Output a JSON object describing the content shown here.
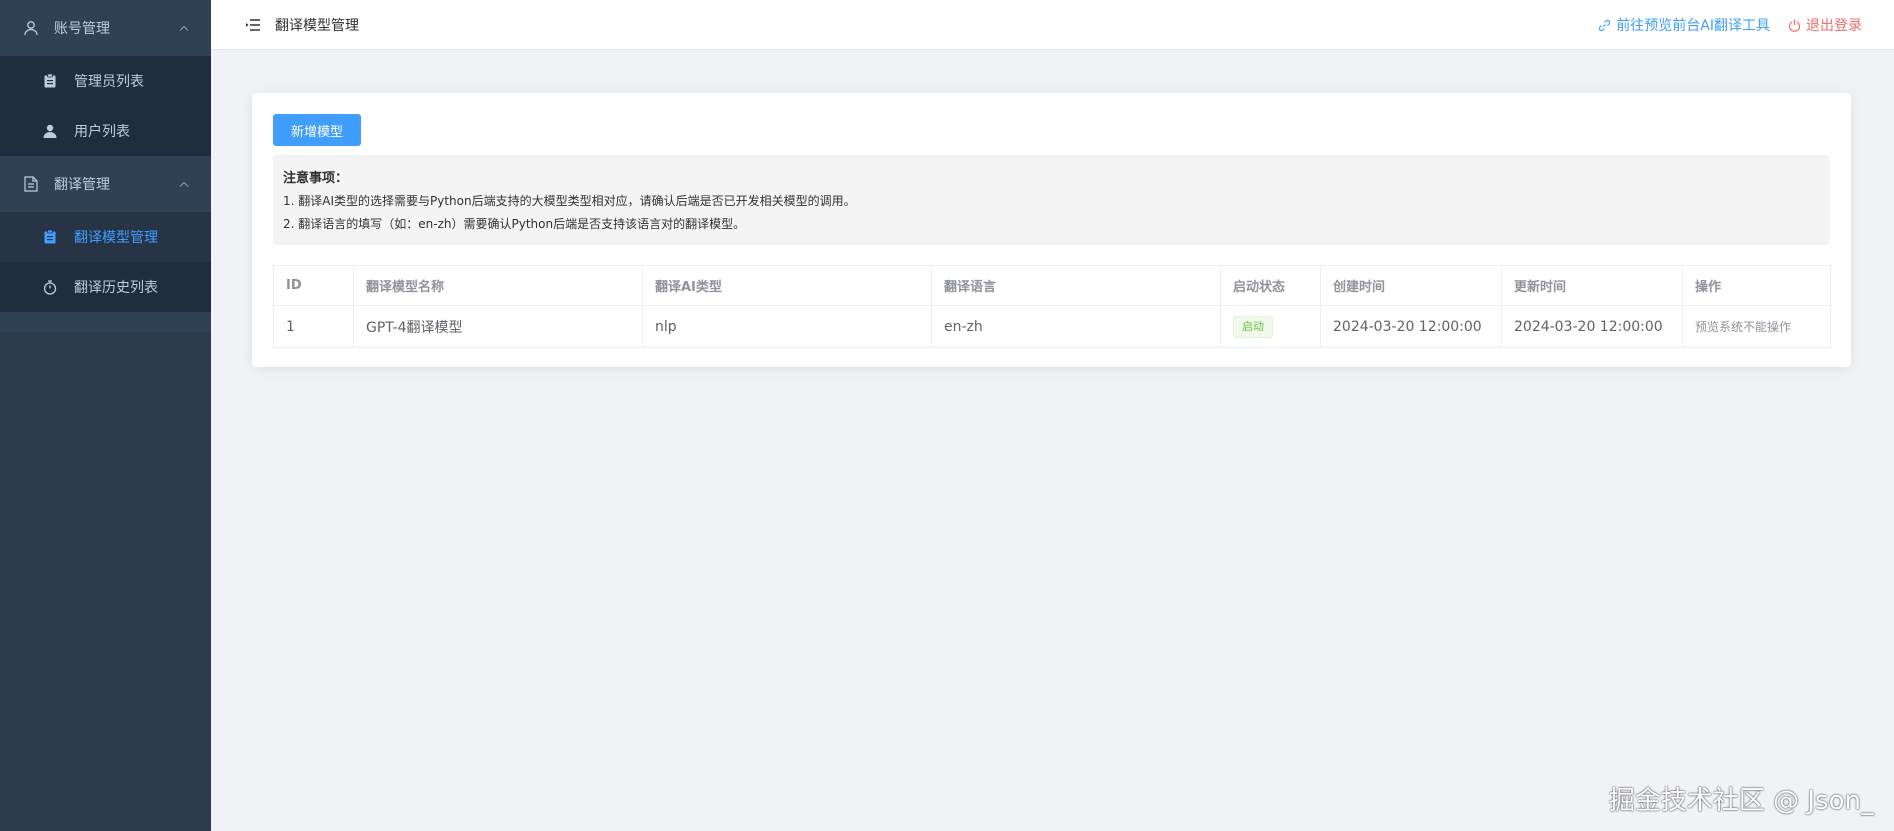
{
  "sidebar": {
    "groups": [
      {
        "label": "账号管理",
        "icon": "user-icon",
        "items": [
          {
            "label": "管理员列表",
            "icon": "clipboard-icon"
          },
          {
            "label": "用户列表",
            "icon": "user-filled-icon"
          }
        ]
      },
      {
        "label": "翻译管理",
        "icon": "document-icon",
        "items": [
          {
            "label": "翻译模型管理",
            "icon": "clipboard-icon",
            "active": true
          },
          {
            "label": "翻译历史列表",
            "icon": "stopwatch-icon"
          }
        ]
      }
    ]
  },
  "header": {
    "title": "翻译模型管理",
    "preview_link": "前往预览前台AI翻译工具",
    "logout": "退出登录"
  },
  "main": {
    "add_button": "新增模型",
    "notice": {
      "title": "注意事项：",
      "lines": [
        "1. 翻译AI类型的选择需要与Python后端支持的大模型类型相对应，请确认后端是否已开发相关模型的调用。",
        "2. 翻译语言的填写（如：en-zh）需要确认Python后端是否支持该语言对的翻译模型。"
      ]
    },
    "table": {
      "headers": [
        "ID",
        "翻译模型名称",
        "翻译AI类型",
        "翻译语言",
        "启动状态",
        "创建时间",
        "更新时间",
        "操作"
      ],
      "rows": [
        {
          "id": "1",
          "name": "GPT-4翻译模型",
          "ai_type": "nlp",
          "language": "en-zh",
          "status": "启动",
          "created": "2024-03-20 12:00:00",
          "updated": "2024-03-20 12:00:00",
          "action": "预览系统不能操作"
        }
      ]
    }
  },
  "watermark": "掘金技术社区 @ Json_",
  "colors": {
    "sidebar_bg": "#304156",
    "submenu_bg": "#1f2d3d",
    "accent": "#409eff",
    "danger": "#f56c6c",
    "success": "#67c23a"
  }
}
